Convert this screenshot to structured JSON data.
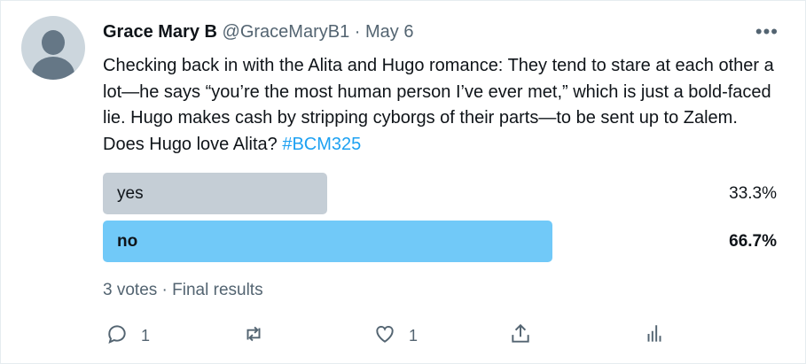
{
  "tweet": {
    "author_name": "Grace Mary B",
    "handle": "@GraceMaryB1",
    "separator": "·",
    "date": "May 6",
    "more_label": "•••",
    "text": "Checking back in with the Alita and Hugo romance: They tend to stare at each other a lot—he says “you’re the most human person I’ve ever met,” which is just a bold-faced lie. Hugo makes cash by stripping cyborgs of their parts—to be sent up to Zalem. Does Hugo love Alita? ",
    "hashtag": "#BCM325"
  },
  "poll": {
    "options": [
      {
        "label": "yes",
        "percent_text": "33.3%",
        "fraction": 0.333,
        "winner": false
      },
      {
        "label": "no",
        "percent_text": "66.7%",
        "fraction": 0.667,
        "winner": true
      }
    ],
    "votes_text": "3 votes",
    "status_text": "Final results",
    "colors": {
      "winner": "#71c9f8",
      "loser": "#c5ced6"
    }
  },
  "actions": {
    "reply_count": "1",
    "retweet_count": "",
    "like_count": "1",
    "icons": [
      "reply-icon",
      "retweet-icon",
      "like-icon",
      "share-icon",
      "analytics-icon"
    ]
  }
}
